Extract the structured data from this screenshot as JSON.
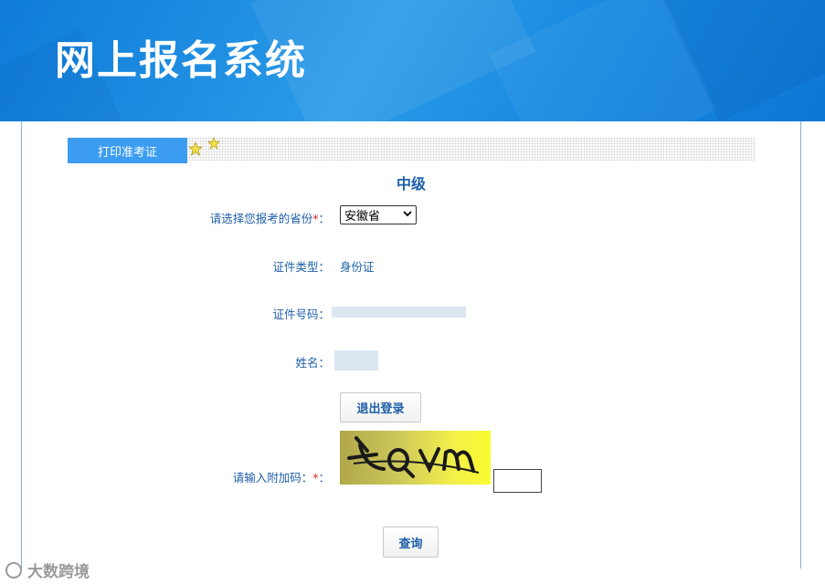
{
  "header": {
    "title": "网上报名系统"
  },
  "tab": {
    "label": "打印准考证"
  },
  "level": "中级",
  "form": {
    "province": {
      "label": "请选择您报考的省份",
      "required_mark": "*",
      "colon": "：",
      "selected": "安徽省"
    },
    "id_type": {
      "label": "证件类型：",
      "value": "身份证"
    },
    "id_number": {
      "label": "证件号码："
    },
    "name": {
      "label": "姓名："
    },
    "logout_button": "退出登录",
    "captcha": {
      "label": "请输入附加码：",
      "required_mark": "*",
      "colon": "：",
      "image_text": "tQvm"
    },
    "query_button": "查询"
  },
  "watermark": {
    "text": "大数跨境"
  },
  "colors": {
    "header": "#1889e0",
    "tab": "#3b9cf0",
    "label": "#1f5fa8",
    "required": "#e02020"
  }
}
